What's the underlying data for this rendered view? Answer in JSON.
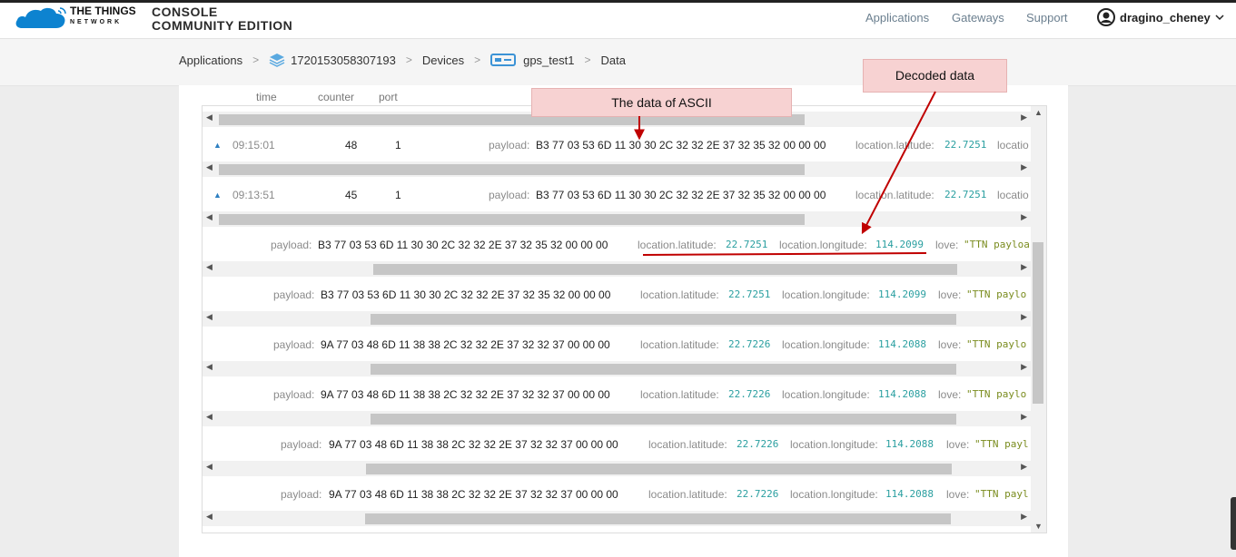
{
  "header": {
    "brand_line1": "THE THINGS",
    "brand_line2": "NETWORK",
    "console_line1": "CONSOLE",
    "console_line2": "COMMUNITY EDITION",
    "nav": [
      "Applications",
      "Gateways",
      "Support"
    ],
    "username": "dragino_cheney"
  },
  "breadcrumb": {
    "items": [
      "Applications",
      "1720153058307193",
      "Devices",
      "gps_test1",
      "Data"
    ],
    "separator": ">"
  },
  "table": {
    "columns": [
      "time",
      "counter",
      "port"
    ],
    "labels": {
      "payload": "payload:",
      "latitude": "location.latitude:",
      "longitude": "location.longitude:",
      "love": "love:",
      "location_cut": "locatio"
    },
    "top_rows": [
      {
        "time": "09:15:01",
        "counter": "48",
        "port": "1",
        "payload": "B3 77 03 53 6D 11 30 30 2C 32 32 2E 37 32 35 32 00 00 00",
        "latitude": "22.7251"
      },
      {
        "time": "09:13:51",
        "counter": "45",
        "port": "1",
        "payload": "B3 77 03 53 6D 11 30 30 2C 32 32 2E 37 32 35 32 00 00 00",
        "latitude": "22.7251"
      }
    ],
    "payload_rows": [
      {
        "payload": "B3 77 03 53 6D 11 30 30 2C 32 32 2E 37 32 35 32 00 00 00",
        "latitude": "22.7251",
        "longitude": "114.2099",
        "love": "\"TTN payloa"
      },
      {
        "payload": "B3 77 03 53 6D 11 30 30 2C 32 32 2E 37 32 35 32 00 00 00",
        "latitude": "22.7251",
        "longitude": "114.2099",
        "love": "\"TTN paylo"
      },
      {
        "payload": "9A 77 03 48 6D 11 38 38 2C 32 32 2E 37 32 32 37 00 00 00",
        "latitude": "22.7226",
        "longitude": "114.2088",
        "love": "\"TTN paylo"
      },
      {
        "payload": "9A 77 03 48 6D 11 38 38 2C 32 32 2E 37 32 32 37 00 00 00",
        "latitude": "22.7226",
        "longitude": "114.2088",
        "love": "\"TTN paylo"
      },
      {
        "payload": "9A 77 03 48 6D 11 38 38 2C 32 32 2E 37 32 32 37 00 00 00",
        "latitude": "22.7226",
        "longitude": "114.2088",
        "love": "\"TTN payl"
      },
      {
        "payload": "9A 77 03 48 6D 11 38 38 2C 32 32 2E 37 32 32 37 00 00 00",
        "latitude": "22.7226",
        "longitude": "114.2088",
        "love": "\"TTN payl"
      }
    ]
  },
  "annotations": {
    "ascii_label": "The data of ASCII",
    "decoded_label": "Decoded data",
    "annotation_color": "#c00000",
    "callout_bg": "#f7d2d2"
  },
  "colors": {
    "nav": "#6b7f8f",
    "number": "#2a9fa0",
    "string": "#7a8c1e",
    "accent": "#2d7fc1"
  },
  "icons": [
    "ttn-cloud-icon",
    "user-avatar-icon",
    "chevron-down-icon",
    "application-stack-icon",
    "device-icon",
    "expand-triangle-icon",
    "scroll-arrow-icon"
  ]
}
